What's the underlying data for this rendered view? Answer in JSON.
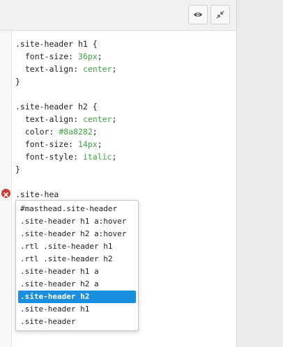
{
  "toolbar": {
    "icons": [
      "eye-icon",
      "collapse-icon"
    ]
  },
  "editor": {
    "lines": [
      [
        {
          "text": ".site-header h1 {"
        }
      ],
      [
        {
          "text": "  font-size: "
        },
        {
          "text": "36px",
          "cls": "val"
        },
        {
          "text": ";"
        }
      ],
      [
        {
          "text": "  text-align: "
        },
        {
          "text": "center",
          "cls": "val"
        },
        {
          "text": ";"
        }
      ],
      [
        {
          "text": "}"
        }
      ],
      [
        {
          "text": ""
        }
      ],
      [
        {
          "text": ".site-header h2 {"
        }
      ],
      [
        {
          "text": "  text-align: "
        },
        {
          "text": "center",
          "cls": "val"
        },
        {
          "text": ";"
        }
      ],
      [
        {
          "text": "  color: "
        },
        {
          "text": "#8a8282",
          "cls": "val"
        },
        {
          "text": ";"
        }
      ],
      [
        {
          "text": "  font-size: "
        },
        {
          "text": "14px",
          "cls": "val"
        },
        {
          "text": ";"
        }
      ],
      [
        {
          "text": "  font-style: "
        },
        {
          "text": "italic",
          "cls": "val"
        },
        {
          "text": ";"
        }
      ],
      [
        {
          "text": "}"
        }
      ],
      [
        {
          "text": ""
        }
      ],
      [
        {
          "text": ".site-hea"
        }
      ]
    ],
    "error_line": 13,
    "colors": {
      "value": "#3fa541",
      "error": "#cc3b31",
      "selection": "#1a8fe0"
    }
  },
  "autocomplete": {
    "items": [
      "#masthead.site-header",
      ".site-header h1 a:hover",
      ".site-header h2 a:hover",
      ".rtl .site-header h1",
      ".rtl .site-header h2",
      ".site-header h1 a",
      ".site-header h2 a",
      ".site-header h2",
      ".site-header h1",
      ".site-header"
    ],
    "selected_index": 7
  }
}
